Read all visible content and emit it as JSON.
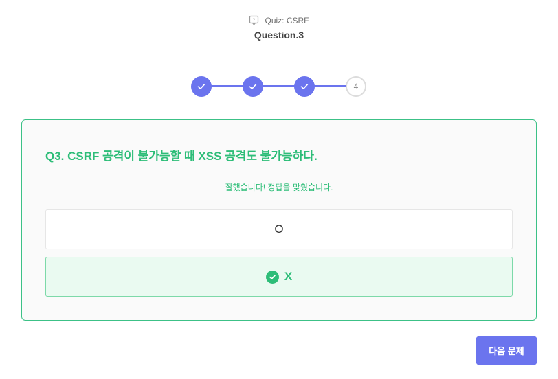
{
  "header": {
    "quiz_label": "Quiz: CSRF",
    "quiz_icon": "quiz-icon",
    "question_title": "Question.3"
  },
  "stepper": {
    "steps": [
      {
        "state": "done",
        "icon": "check-icon"
      },
      {
        "state": "done",
        "icon": "check-icon"
      },
      {
        "state": "done",
        "icon": "check-icon"
      },
      {
        "state": "current",
        "label": "4"
      }
    ],
    "active_color": "#6b74ee"
  },
  "question": {
    "text": "Q3. CSRF 공격이 불가능할 때 XSS 공격도 불가능하다.",
    "feedback": "잘했습니다! 정답을 맞췄습니다.",
    "options": [
      {
        "label": "O",
        "state": "default"
      },
      {
        "label": "X",
        "state": "correct",
        "icon": "check-circle-icon"
      }
    ],
    "correct_color": "#2dbd78"
  },
  "actions": {
    "next_label": "다음 문제"
  }
}
